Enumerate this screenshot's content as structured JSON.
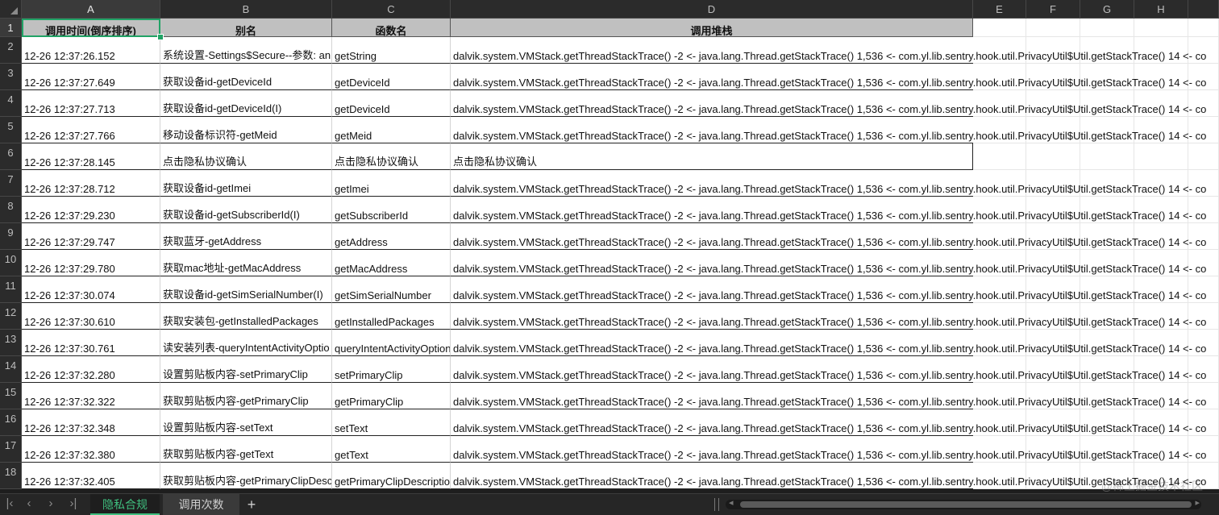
{
  "sheet": {
    "columns": [
      "A",
      "B",
      "C",
      "D",
      "E",
      "F",
      "G",
      "H"
    ],
    "selected_column": "A",
    "selected_row": "1",
    "header_row": [
      "调用时间(倒序排序)",
      "别名",
      "函数名",
      "调用堆栈"
    ],
    "rows": [
      {
        "num": "1"
      },
      {
        "num": "2",
        "time": "12-26 12:37:26.152",
        "alias": "系统设置-Settings$Secure--参数: an",
        "func": "getString",
        "stack": "dalvik.system.VMStack.getThreadStackTrace() -2 <- java.lang.Thread.getStackTrace() 1,536 <- com.yl.lib.sentry.hook.util.PrivacyUtil$Util.getStackTrace() 14 <- co"
      },
      {
        "num": "3",
        "time": "12-26 12:37:27.649",
        "alias": "获取设备id-getDeviceId",
        "func": "getDeviceId",
        "stack": "dalvik.system.VMStack.getThreadStackTrace() -2 <- java.lang.Thread.getStackTrace() 1,536 <- com.yl.lib.sentry.hook.util.PrivacyUtil$Util.getStackTrace() 14 <- co"
      },
      {
        "num": "4",
        "time": "12-26 12:37:27.713",
        "alias": "获取设备id-getDeviceId(I)",
        "func": "getDeviceId",
        "stack": "dalvik.system.VMStack.getThreadStackTrace() -2 <- java.lang.Thread.getStackTrace() 1,536 <- com.yl.lib.sentry.hook.util.PrivacyUtil$Util.getStackTrace() 14 <- co"
      },
      {
        "num": "5",
        "time": "12-26 12:37:27.766",
        "alias": "移动设备标识符-getMeid",
        "func": "getMeid",
        "stack": "dalvik.system.VMStack.getThreadStackTrace() -2 <- java.lang.Thread.getStackTrace() 1,536 <- com.yl.lib.sentry.hook.util.PrivacyUtil$Util.getStackTrace() 14 <- co"
      },
      {
        "num": "6",
        "time": "12-26 12:37:28.145",
        "alias": "点击隐私协议确认",
        "func": "点击隐私协议确认",
        "stack": "点击隐私协议确认"
      },
      {
        "num": "7",
        "time": "12-26 12:37:28.712",
        "alias": "获取设备id-getImei",
        "func": "getImei",
        "stack": "dalvik.system.VMStack.getThreadStackTrace() -2 <- java.lang.Thread.getStackTrace() 1,536 <- com.yl.lib.sentry.hook.util.PrivacyUtil$Util.getStackTrace() 14 <- co"
      },
      {
        "num": "8",
        "time": "12-26 12:37:29.230",
        "alias": "获取设备id-getSubscriberId(I)",
        "func": "getSubscriberId",
        "stack": "dalvik.system.VMStack.getThreadStackTrace() -2 <- java.lang.Thread.getStackTrace() 1,536 <- com.yl.lib.sentry.hook.util.PrivacyUtil$Util.getStackTrace() 14 <- co"
      },
      {
        "num": "9",
        "time": "12-26 12:37:29.747",
        "alias": "获取蓝牙-getAddress",
        "func": "getAddress",
        "stack": "dalvik.system.VMStack.getThreadStackTrace() -2 <- java.lang.Thread.getStackTrace() 1,536 <- com.yl.lib.sentry.hook.util.PrivacyUtil$Util.getStackTrace() 14 <- co"
      },
      {
        "num": "10",
        "time": "12-26 12:37:29.780",
        "alias": "获取mac地址-getMacAddress",
        "func": "getMacAddress",
        "stack": "dalvik.system.VMStack.getThreadStackTrace() -2 <- java.lang.Thread.getStackTrace() 1,536 <- com.yl.lib.sentry.hook.util.PrivacyUtil$Util.getStackTrace() 14 <- co"
      },
      {
        "num": "11",
        "time": "12-26 12:37:30.074",
        "alias": "获取设备id-getSimSerialNumber(I)",
        "func": "getSimSerialNumber",
        "stack": "dalvik.system.VMStack.getThreadStackTrace() -2 <- java.lang.Thread.getStackTrace() 1,536 <- com.yl.lib.sentry.hook.util.PrivacyUtil$Util.getStackTrace() 14 <- co"
      },
      {
        "num": "12",
        "time": "12-26 12:37:30.610",
        "alias": "获取安装包-getInstalledPackages",
        "func": "getInstalledPackages",
        "stack": "dalvik.system.VMStack.getThreadStackTrace() -2 <- java.lang.Thread.getStackTrace() 1,536 <- com.yl.lib.sentry.hook.util.PrivacyUtil$Util.getStackTrace() 14 <- co"
      },
      {
        "num": "13",
        "time": "12-26 12:37:30.761",
        "alias": "读安装列表-queryIntentActivityOptio",
        "func": "queryIntentActivityOption",
        "stack": "dalvik.system.VMStack.getThreadStackTrace() -2 <- java.lang.Thread.getStackTrace() 1,536 <- com.yl.lib.sentry.hook.util.PrivacyUtil$Util.getStackTrace() 14 <- co"
      },
      {
        "num": "14",
        "time": "12-26 12:37:32.280",
        "alias": "设置剪贴板内容-setPrimaryClip",
        "func": "setPrimaryClip",
        "stack": "dalvik.system.VMStack.getThreadStackTrace() -2 <- java.lang.Thread.getStackTrace() 1,536 <- com.yl.lib.sentry.hook.util.PrivacyUtil$Util.getStackTrace() 14 <- co"
      },
      {
        "num": "15",
        "time": "12-26 12:37:32.322",
        "alias": "获取剪贴板内容-getPrimaryClip",
        "func": "getPrimaryClip",
        "stack": "dalvik.system.VMStack.getThreadStackTrace() -2 <- java.lang.Thread.getStackTrace() 1,536 <- com.yl.lib.sentry.hook.util.PrivacyUtil$Util.getStackTrace() 14 <- co"
      },
      {
        "num": "16",
        "time": "12-26 12:37:32.348",
        "alias": "设置剪贴板内容-setText",
        "func": "setText",
        "stack": "dalvik.system.VMStack.getThreadStackTrace() -2 <- java.lang.Thread.getStackTrace() 1,536 <- com.yl.lib.sentry.hook.util.PrivacyUtil$Util.getStackTrace() 14 <- co"
      },
      {
        "num": "17",
        "time": "12-26 12:37:32.380",
        "alias": "获取剪贴板内容-getText",
        "func": "getText",
        "stack": "dalvik.system.VMStack.getThreadStackTrace() -2 <- java.lang.Thread.getStackTrace() 1,536 <- com.yl.lib.sentry.hook.util.PrivacyUtil$Util.getStackTrace() 14 <- co"
      },
      {
        "num": "18",
        "time": "12-26 12:37:32.405",
        "alias": "获取剪贴板内容-getPrimaryClipDesc",
        "func": "getPrimaryClipDescription",
        "stack": "dalvik.system.VMStack.getThreadStackTrace() -2 <- java.lang.Thread.getStackTrace() 1,536 <- com.yl.lib.sentry.hook.util.PrivacyUtil$Util.getStackTrace() 14 <- co"
      }
    ]
  },
  "tabs": {
    "nav_icons": [
      "first-sheet-icon",
      "prev-sheet-icon",
      "next-sheet-icon",
      "last-sheet-icon"
    ],
    "sheets": [
      {
        "label": "隐私合规",
        "active": true
      },
      {
        "label": "调用次数",
        "active": false
      }
    ],
    "add_label": "+"
  },
  "watermark": "@稀土掘金技术社区",
  "colors": {
    "accent": "#21a366",
    "header_fill": "#c0c0c0",
    "chrome": "#2b2b2b"
  }
}
